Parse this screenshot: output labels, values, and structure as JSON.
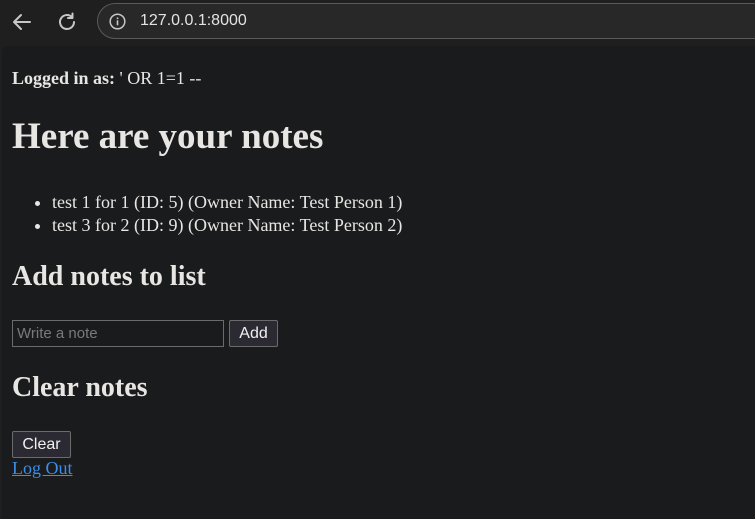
{
  "browser": {
    "url": "127.0.0.1:8000"
  },
  "page": {
    "logged_in_label": "Logged in as:",
    "logged_in_user": " ' OR 1=1 --",
    "title": "Here are your notes",
    "notes": [
      "test 1 for 1 (ID: 5) (Owner Name: Test Person 1)",
      "test 3 for 2 (ID: 9) (Owner Name: Test Person 2)"
    ],
    "add_heading": "Add notes to list",
    "note_input_placeholder": "Write a note",
    "add_button": "Add",
    "clear_heading": "Clear notes",
    "clear_button": "Clear",
    "logout_link": "Log Out"
  },
  "colors": {
    "page_background": "#1a1b1d",
    "text": "#e8e6e3",
    "link": "#3b8eea"
  },
  "icons": {
    "back": "arrow-left-icon",
    "reload": "reload-icon",
    "site_info": "info-icon"
  }
}
